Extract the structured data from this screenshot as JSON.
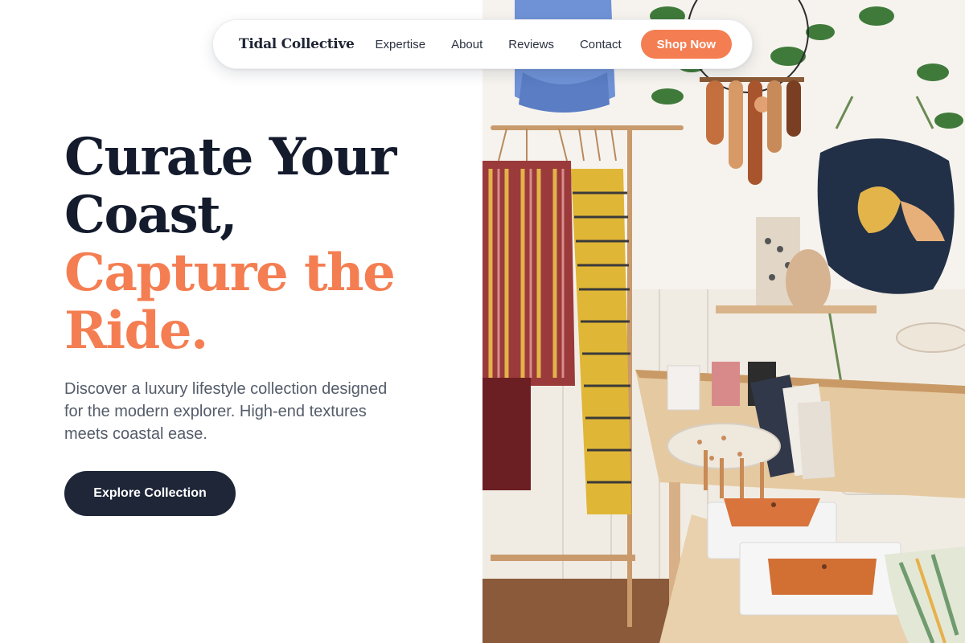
{
  "nav": {
    "brand": "Tidal Collective",
    "links": [
      {
        "label": "Expertise"
      },
      {
        "label": "About"
      },
      {
        "label": "Reviews"
      },
      {
        "label": "Contact"
      }
    ],
    "cta_label": "Shop Now"
  },
  "hero": {
    "headline_line1": "Curate Your",
    "headline_line2": "Coast,",
    "headline_accent_line1": "Capture the",
    "headline_accent_line2": "Ride.",
    "description": "Discover a luxury lifestyle collection designed for the modern explorer. High-end textures meets coastal ease.",
    "cta_label": "Explore Collection"
  },
  "colors": {
    "accent": "#f47e52",
    "dark": "#141b2d",
    "button_dark": "#1e2638",
    "body_text": "#545c6a"
  }
}
